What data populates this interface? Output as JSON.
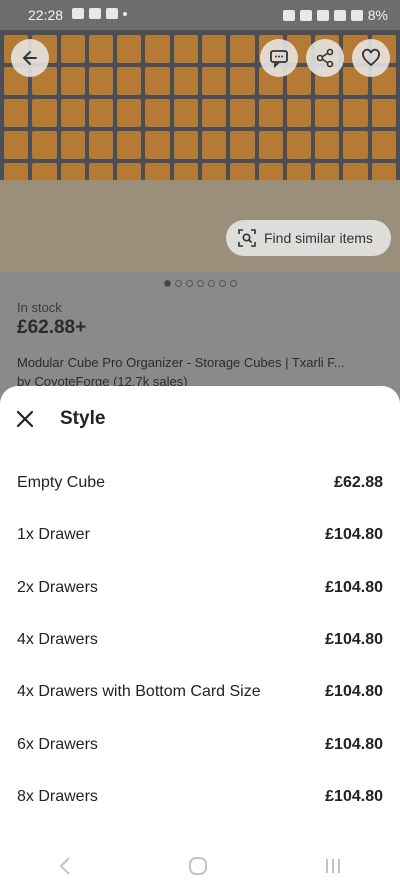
{
  "status_bar": {
    "time": "22:28",
    "battery": "8%"
  },
  "photo": {
    "find_similar_label": "Find similar items",
    "image_count": 7,
    "active_index": 0
  },
  "product": {
    "stock": "In stock",
    "price": "£62.88+",
    "title": "Modular Cube Pro Organizer - Storage Cubes | Txarli F...",
    "byline": "by CoyoteForge (12.7k sales)"
  },
  "sheet": {
    "title": "Style",
    "options": [
      {
        "label": "Empty Cube",
        "price": "£62.88"
      },
      {
        "label": "1x Drawer",
        "price": "£104.80"
      },
      {
        "label": "2x Drawers",
        "price": "£104.80"
      },
      {
        "label": "4x Drawers",
        "price": "£104.80"
      },
      {
        "label": "4x Drawers with Bottom Card Size",
        "price": "£104.80"
      },
      {
        "label": "6x Drawers",
        "price": "£104.80"
      },
      {
        "label": "8x Drawers",
        "price": "£104.80"
      }
    ]
  },
  "icons": {
    "back": "arrow-left-icon",
    "message": "message-icon",
    "share": "share-icon",
    "favorite": "heart-icon",
    "visual_search": "image-search-icon",
    "close": "close-icon"
  },
  "colors": {
    "sheet_bg": "#ffffff",
    "overlay": "#8a8a8a",
    "cube_orange": "#b57a34"
  }
}
